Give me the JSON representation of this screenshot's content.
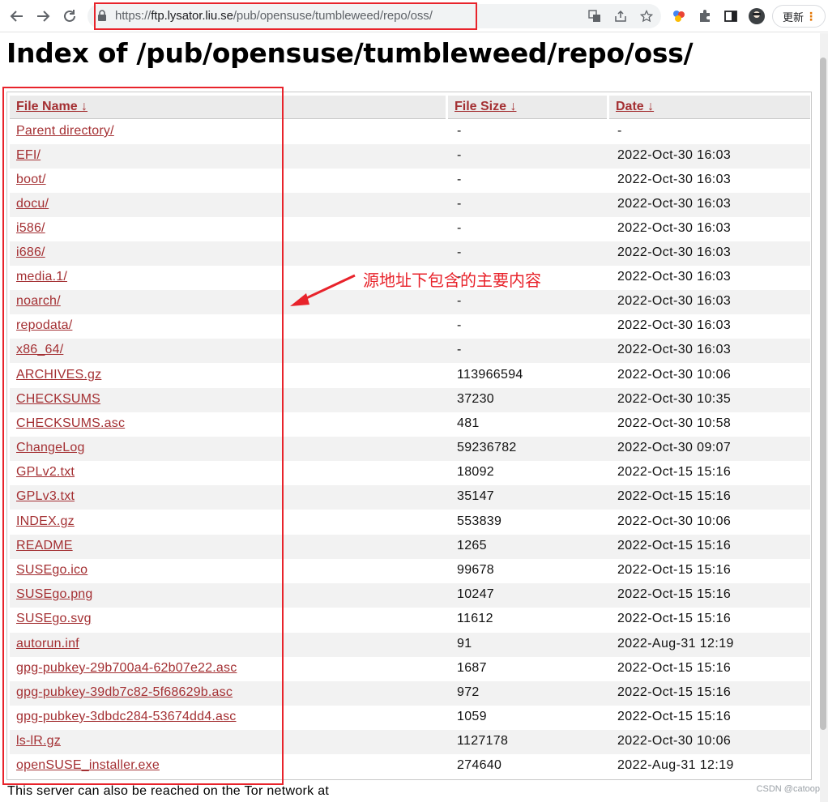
{
  "browser": {
    "url_scheme": "https://",
    "url_host": "ftp.lysator.liu.se",
    "url_path": "/pub/opensuse/tumbleweed/repo/oss/",
    "update_label": "更新"
  },
  "page": {
    "title": "Index of /pub/opensuse/tumbleweed/repo/oss/",
    "columns": {
      "name": "File Name  ↓",
      "size": "File Size  ↓",
      "date": "Date  ↓"
    },
    "rows": [
      {
        "name": "Parent directory/",
        "size": "-",
        "date": "-"
      },
      {
        "name": "EFI/",
        "size": "-",
        "date": "2022-Oct-30 16:03"
      },
      {
        "name": "boot/",
        "size": "-",
        "date": "2022-Oct-30 16:03"
      },
      {
        "name": "docu/",
        "size": "-",
        "date": "2022-Oct-30 16:03"
      },
      {
        "name": "i586/",
        "size": "-",
        "date": "2022-Oct-30 16:03"
      },
      {
        "name": "i686/",
        "size": "-",
        "date": "2022-Oct-30 16:03"
      },
      {
        "name": "media.1/",
        "size": "-",
        "date": "2022-Oct-30 16:03"
      },
      {
        "name": "noarch/",
        "size": "-",
        "date": "2022-Oct-30 16:03"
      },
      {
        "name": "repodata/",
        "size": "-",
        "date": "2022-Oct-30 16:03"
      },
      {
        "name": "x86_64/",
        "size": "-",
        "date": "2022-Oct-30 16:03"
      },
      {
        "name": "ARCHIVES.gz",
        "size": "113966594",
        "date": "2022-Oct-30 10:06"
      },
      {
        "name": "CHECKSUMS",
        "size": "37230",
        "date": "2022-Oct-30 10:35"
      },
      {
        "name": "CHECKSUMS.asc",
        "size": "481",
        "date": "2022-Oct-30 10:58"
      },
      {
        "name": "ChangeLog",
        "size": "59236782",
        "date": "2022-Oct-30 09:07"
      },
      {
        "name": "GPLv2.txt",
        "size": "18092",
        "date": "2022-Oct-15 15:16"
      },
      {
        "name": "GPLv3.txt",
        "size": "35147",
        "date": "2022-Oct-15 15:16"
      },
      {
        "name": "INDEX.gz",
        "size": "553839",
        "date": "2022-Oct-30 10:06"
      },
      {
        "name": "README",
        "size": "1265",
        "date": "2022-Oct-15 15:16"
      },
      {
        "name": "SUSEgo.ico",
        "size": "99678",
        "date": "2022-Oct-15 15:16"
      },
      {
        "name": "SUSEgo.png",
        "size": "10247",
        "date": "2022-Oct-15 15:16"
      },
      {
        "name": "SUSEgo.svg",
        "size": "11612",
        "date": "2022-Oct-15 15:16"
      },
      {
        "name": "autorun.inf",
        "size": "91",
        "date": "2022-Aug-31 12:19"
      },
      {
        "name": "gpg-pubkey-29b700a4-62b07e22.asc",
        "size": "1687",
        "date": "2022-Oct-15 15:16"
      },
      {
        "name": "gpg-pubkey-39db7c82-5f68629b.asc",
        "size": "972",
        "date": "2022-Oct-15 15:16"
      },
      {
        "name": "gpg-pubkey-3dbdc284-53674dd4.asc",
        "size": "1059",
        "date": "2022-Oct-15 15:16"
      },
      {
        "name": "ls-lR.gz",
        "size": "1127178",
        "date": "2022-Oct-30 10:06"
      },
      {
        "name": "openSUSE_installer.exe",
        "size": "274640",
        "date": "2022-Aug-31 12:19"
      }
    ],
    "footer": "This server can also be reached on the Tor network at"
  },
  "annotation": {
    "text": "源地址下包含的主要内容",
    "color": "#e8232b"
  },
  "watermark": "CSDN @catoop",
  "colors": {
    "link": "#a43033",
    "header_bg": "#ebebeb",
    "alt_row_bg": "#f2f2f2",
    "highlight": "#e8232b"
  }
}
